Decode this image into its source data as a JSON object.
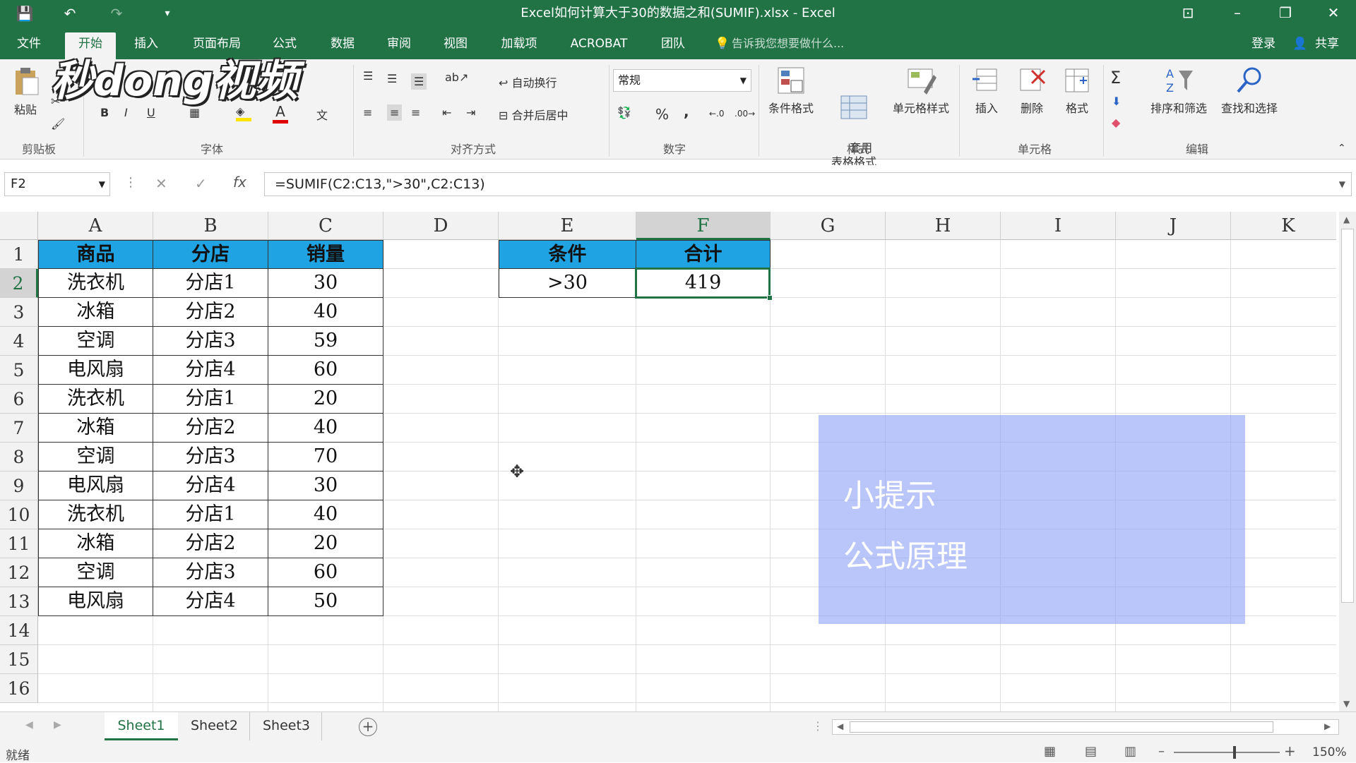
{
  "window": {
    "title": "Excel如何计算大于30的数据之和(SUMIF).xlsx - Excel",
    "minimize": "–",
    "restore": "❐",
    "close": "✕",
    "ribbon_toggle": "⊡"
  },
  "quick_access": {
    "save": "💾",
    "undo": "↶",
    "redo": "↷",
    "customize": "▾"
  },
  "menu": {
    "tabs": [
      "文件",
      "开始",
      "插入",
      "页面布局",
      "公式",
      "数据",
      "审阅",
      "视图",
      "加载项",
      "ACROBAT",
      "团队"
    ],
    "tell_me": "告诉我您想要做什么...",
    "login": "登录",
    "share": "共享"
  },
  "ribbon": {
    "clipboard": {
      "paste": "粘贴",
      "group": "剪贴板"
    },
    "font": {
      "bold": "B",
      "italic": "I",
      "underline": "U",
      "font_color": "A",
      "group": "字体"
    },
    "alignment": {
      "wrap": "自动换行",
      "merge": "合并后居中",
      "group": "对齐方式"
    },
    "number": {
      "format": "常规",
      "percent": "%",
      "comma": ",",
      "group": "数字"
    },
    "styles": {
      "conditional": "条件格式",
      "table": "套用\n表格格式",
      "cell": "单元格样式",
      "group": "样式"
    },
    "cells": {
      "insert": "插入",
      "delete": "删除",
      "format": "格式",
      "group": "单元格"
    },
    "editing": {
      "sort": "排序和筛选",
      "find": "查找和选择",
      "group": "编辑"
    }
  },
  "formula_bar": {
    "name_box": "F2",
    "cancel": "✕",
    "enter": "✓",
    "fx": "fx",
    "formula": "=SUMIF(C2:C13,\">30\",C2:C13)"
  },
  "grid": {
    "columns": [
      "A",
      "B",
      "C",
      "D",
      "E",
      "F",
      "G",
      "H",
      "I",
      "J",
      "K"
    ],
    "rows": [
      "1",
      "2",
      "3",
      "4",
      "5",
      "6",
      "7",
      "8",
      "9",
      "10",
      "11",
      "12",
      "13",
      "14",
      "15",
      "16"
    ],
    "table_headers": [
      "商品",
      "分店",
      "销量"
    ],
    "table_rows": [
      [
        "洗衣机",
        "分店1",
        "30"
      ],
      [
        "冰箱",
        "分店2",
        "40"
      ],
      [
        "空调",
        "分店3",
        "59"
      ],
      [
        "电风扇",
        "分店4",
        "60"
      ],
      [
        "洗衣机",
        "分店1",
        "20"
      ],
      [
        "冰箱",
        "分店2",
        "40"
      ],
      [
        "空调",
        "分店3",
        "70"
      ],
      [
        "电风扇",
        "分店4",
        "30"
      ],
      [
        "洗衣机",
        "分店1",
        "40"
      ],
      [
        "冰箱",
        "分店2",
        "20"
      ],
      [
        "空调",
        "分店3",
        "60"
      ],
      [
        "电风扇",
        "分店4",
        "50"
      ]
    ],
    "criteria_header": "条件",
    "sum_header": "合计",
    "criteria_value": ">30",
    "sum_value": "419",
    "selected_cell": "F2",
    "header_color": "#1fa3e2"
  },
  "tip": {
    "title": "小提示",
    "body": "公式原理"
  },
  "sheets": {
    "tabs": [
      "Sheet1",
      "Sheet2",
      "Sheet3"
    ],
    "active": "Sheet1",
    "add": "+"
  },
  "status": {
    "ready": "就绪",
    "zoom": "150%"
  },
  "watermark": "秒dong视频",
  "colors": {
    "excel_green": "#217346"
  }
}
